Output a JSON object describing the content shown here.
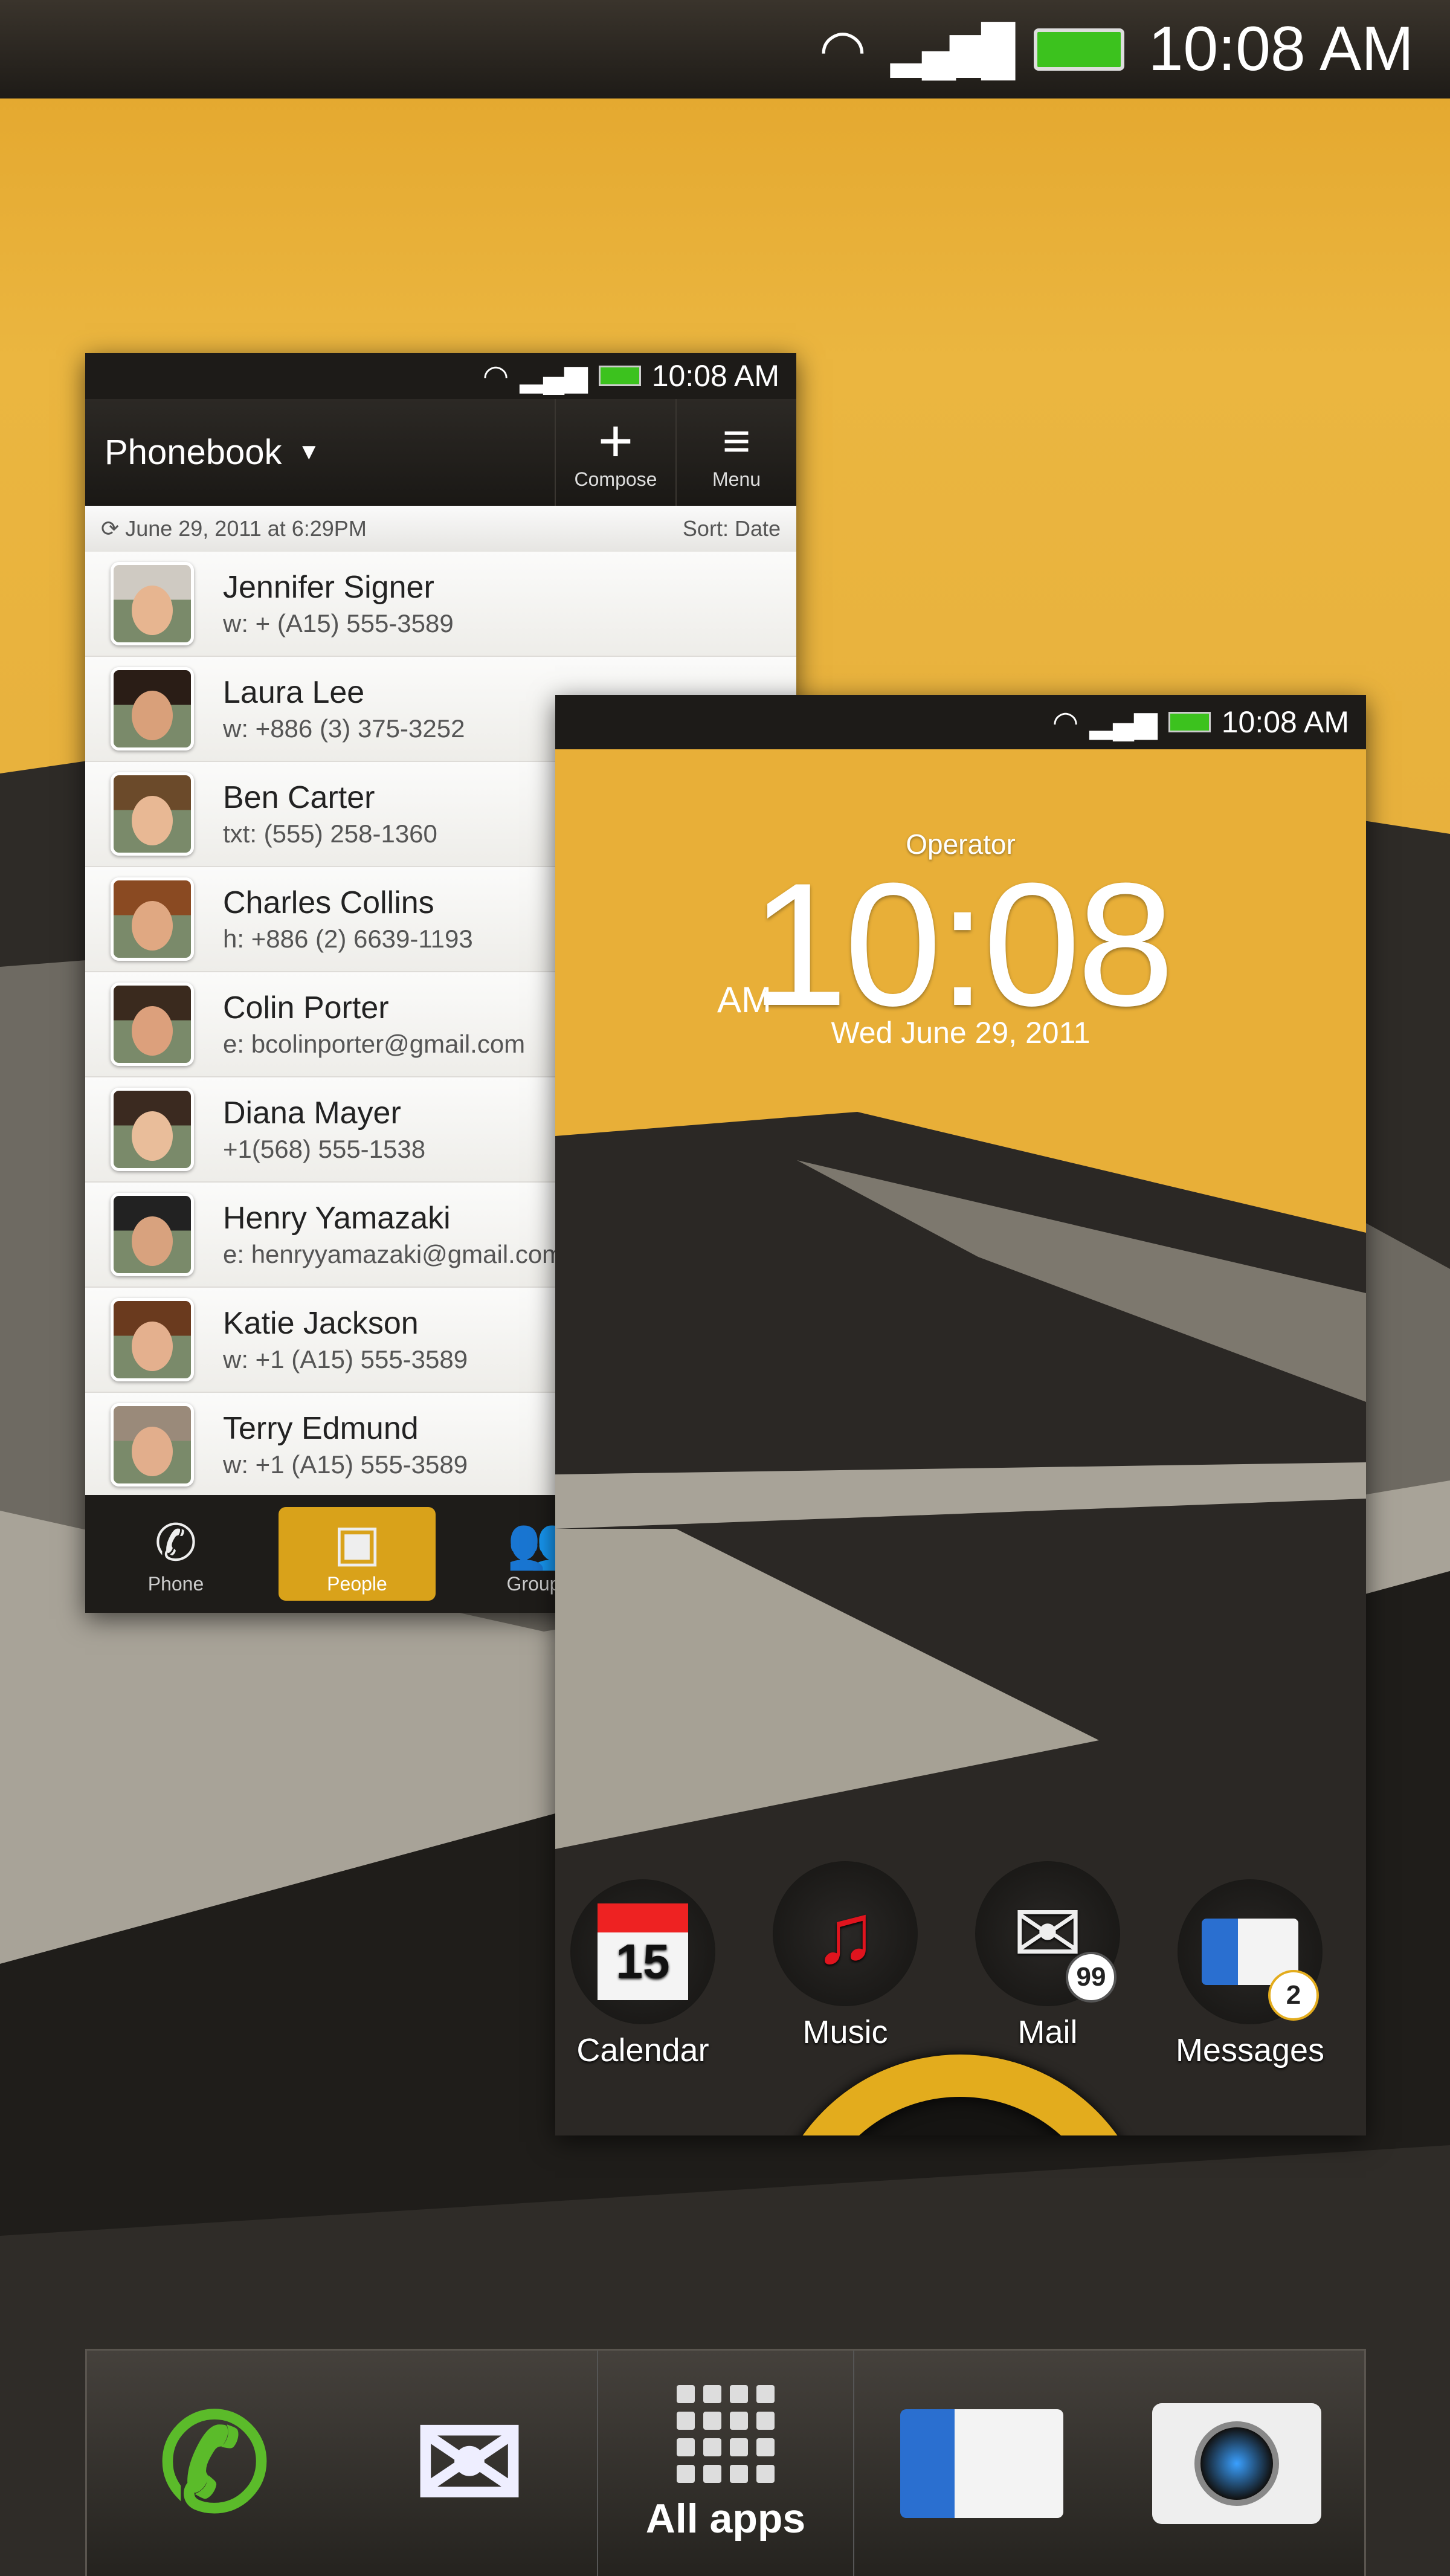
{
  "status_bar": {
    "time": "10:08 AM",
    "wifi_icon": "wifi-icon",
    "signal_icon": "signal-icon",
    "battery_icon": "battery-icon",
    "battery_color": "#3cc21e"
  },
  "phonebook": {
    "status_time": "10:08 AM",
    "title": "Phonebook",
    "compose_label": "Compose",
    "menu_label": "Menu",
    "sync_text": "June 29, 2011 at 6:29PM",
    "sort_text": "Sort: Date",
    "contacts": [
      {
        "name": "Jennifer Signer",
        "detail": "w: + (A15) 555-3589"
      },
      {
        "name": "Laura Lee",
        "detail": "w: +886 (3) 375-3252"
      },
      {
        "name": "Ben Carter",
        "detail": "txt: (555) 258-1360"
      },
      {
        "name": "Charles Collins",
        "detail": "h: +886 (2) 6639-1193"
      },
      {
        "name": "Colin Porter",
        "detail": "e: bcolinporter@gmail.com"
      },
      {
        "name": "Diana Mayer",
        "detail": "+1(568) 555-1538"
      },
      {
        "name": "Henry Yamazaki",
        "detail": "e: henryyamazaki@gmail.com"
      },
      {
        "name": "Katie Jackson",
        "detail": "w: +1 (A15) 555-3589"
      },
      {
        "name": "Terry Edmund",
        "detail": "w: +1 (A15) 555-3589"
      }
    ],
    "tabs": [
      {
        "label": "Phone",
        "active": false
      },
      {
        "label": "People",
        "active": true
      },
      {
        "label": "Groups",
        "active": false
      }
    ],
    "accent": "#d9a21a"
  },
  "lockscreen": {
    "status_time": "10:08 AM",
    "operator": "Operator",
    "clock": "10:08",
    "ampm": "AM",
    "date": "Wed June 29, 2011",
    "apps": [
      {
        "label": "Calendar",
        "icon": "calendar-icon",
        "icon_text": "15"
      },
      {
        "label": "Music",
        "icon": "music-note-icon"
      },
      {
        "label": "Mail",
        "icon": "mail-icon",
        "badge": "99"
      },
      {
        "label": "Messages",
        "icon": "messages-icon",
        "badge": "2"
      }
    ],
    "ring_color": "#e3ac1d"
  },
  "dock": {
    "items": [
      {
        "icon": "phone-icon"
      },
      {
        "icon": "mail-icon"
      },
      {
        "icon": "all-apps-icon",
        "label": "All apps"
      },
      {
        "icon": "messages-icon"
      },
      {
        "icon": "camera-icon"
      }
    ]
  }
}
